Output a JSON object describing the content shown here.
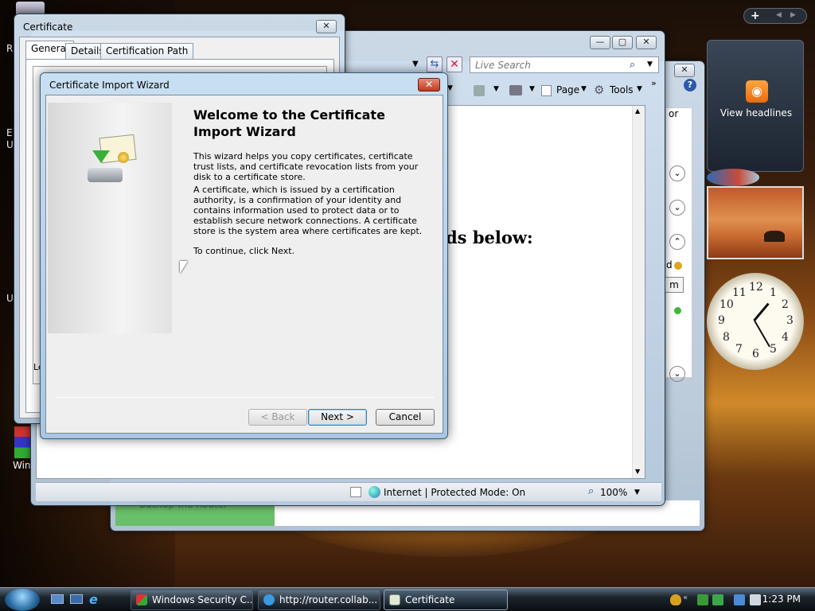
{
  "desktop": {
    "icon_labels": [
      "R",
      "E",
      "U",
      "U",
      "Le",
      "Win"
    ]
  },
  "ie_window": {
    "search_placeholder": "Live Search",
    "toolbar": {
      "page_label": "Page",
      "tools_label": "Tools"
    },
    "content_heading_fragment": "ds below:",
    "side_fragment_or": "or",
    "side_fragment_d": "d",
    "side_fragment_m": "m",
    "bottom_fragment": "Backup the Router",
    "status_zone": "Internet | Protected Mode: On",
    "zoom_level": "100%"
  },
  "certificate_window": {
    "title": "Certificate",
    "tabs": [
      "General",
      "Details",
      "Certification Path"
    ],
    "active_tab": "General"
  },
  "wizard": {
    "title": "Certificate Import Wizard",
    "heading": "Welcome to the Certificate Import Wizard",
    "para1": "This wizard helps you copy certificates, certificate trust lists, and certificate revocation lists from your disk to a certificate store.",
    "para2": "A certificate, which is issued by a certification authority, is a confirmation of your identity and contains information used to protect data or to establish secure network connections. A certificate store is the system area where certificates are kept.",
    "para3": "To continue, click Next.",
    "buttons": {
      "back": "< Back",
      "next": "Next >",
      "cancel": "Cancel"
    }
  },
  "sidebar": {
    "feed_label": "View headlines",
    "clock_numbers": [
      "12",
      "1",
      "2",
      "3",
      "4",
      "5",
      "6",
      "7",
      "8",
      "9",
      "10",
      "11"
    ]
  },
  "taskbar": {
    "tasks": [
      {
        "label": "Windows Security C...",
        "active": false
      },
      {
        "label": "http://router.collab...",
        "active": false
      },
      {
        "label": "Certificate",
        "active": true
      }
    ],
    "time": "1:23 PM"
  }
}
